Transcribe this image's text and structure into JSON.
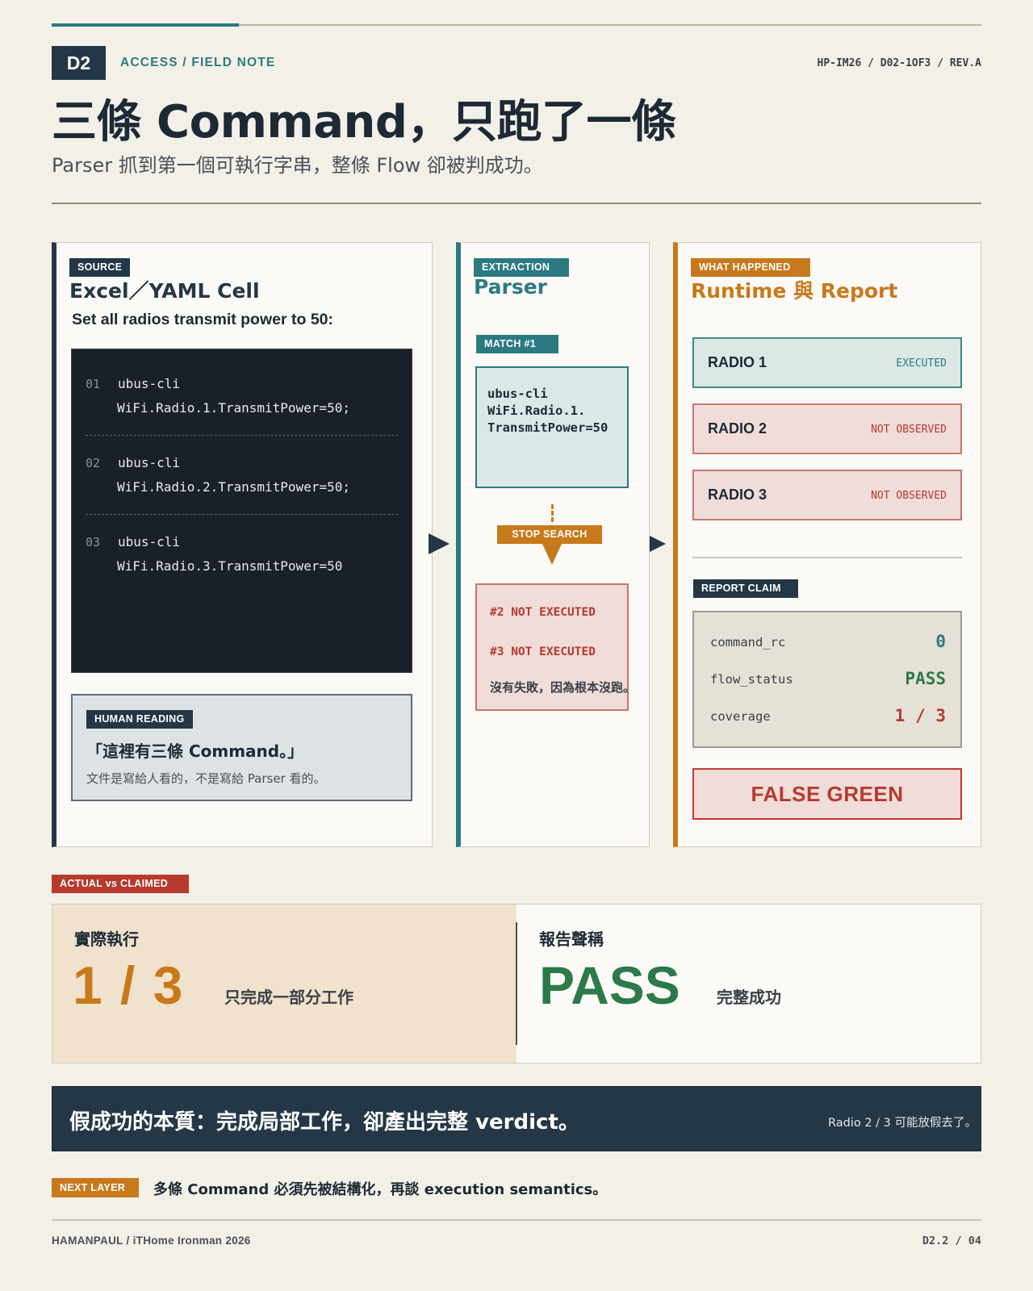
{
  "header": {
    "badge": "D2",
    "kicker": "ACCESS / FIELD NOTE",
    "doc_ref": "HP-IM26 / D02-1OF3 / REV.A",
    "title": "三條 Command，只跑了一條",
    "subtitle": "Parser 抓到第一個可執行字串，整條 Flow 卻被判成功。"
  },
  "source": {
    "tag": "SOURCE",
    "title": "Excel／YAML Cell",
    "instruction": "Set all radios transmit power to 50:",
    "lines": [
      {
        "num": "01",
        "cmd": "ubus-cli",
        "arg": "WiFi.Radio.1.TransmitPower=50;"
      },
      {
        "num": "02",
        "cmd": "ubus-cli",
        "arg": "WiFi.Radio.2.TransmitPower=50;"
      },
      {
        "num": "03",
        "cmd": "ubus-cli",
        "arg": "WiFi.Radio.3.TransmitPower=50"
      }
    ],
    "human": {
      "tag": "HUMAN READING",
      "quote": "「這裡有三條 Command。」",
      "note": "文件是寫給人看的，不是寫給 Parser 看的。"
    }
  },
  "parser": {
    "tag": "EXTRACTION",
    "title": "Parser",
    "match_tag": "MATCH #1",
    "match_lines": [
      "ubus-cli",
      "WiFi.Radio.1.",
      "TransmitPower=50"
    ],
    "stop_label": "STOP SEARCH",
    "not_executed": [
      "#2 NOT EXECUTED",
      "#3 NOT EXECUTED"
    ],
    "note": "沒有失敗，因為根本沒跑。"
  },
  "runtime": {
    "tag": "WHAT HAPPENED",
    "title": "Runtime 與 Report",
    "radios": [
      {
        "name": "RADIO 1",
        "status": "EXECUTED"
      },
      {
        "name": "RADIO 2",
        "status": "NOT OBSERVED"
      },
      {
        "name": "RADIO 3",
        "status": "NOT OBSERVED"
      }
    ],
    "report_tag": "REPORT CLAIM",
    "report": [
      {
        "key": "command_rc",
        "value": "0"
      },
      {
        "key": "flow_status",
        "value": "PASS"
      },
      {
        "key": "coverage",
        "value": "1 / 3"
      }
    ],
    "verdict": "FALSE GREEN"
  },
  "compare": {
    "tag": "ACTUAL vs CLAIMED",
    "actual_label": "實際執行",
    "actual_value": "1 / 3",
    "actual_note": "只完成一部分工作",
    "claimed_label": "報告聲稱",
    "claimed_value": "PASS",
    "claimed_note": "完整成功"
  },
  "banner": {
    "text": "假成功的本質：完成局部工作，卻產出完整 verdict。",
    "side_note": "Radio 2 / 3 可能放假去了。"
  },
  "next": {
    "tag": "NEXT LAYER",
    "text": "多條 Command 必須先被結構化，再談 execution semantics。"
  },
  "footer": {
    "left": "HAMANPAUL / iTHome Ironman 2026",
    "right": "D2.2 / 04"
  },
  "colors": {
    "navy": "#243747",
    "teal": "#2b7a82",
    "orange": "#c8791c",
    "red": "#b63a2e",
    "green": "#2c7a4a",
    "code_bg": "#1a2027"
  }
}
